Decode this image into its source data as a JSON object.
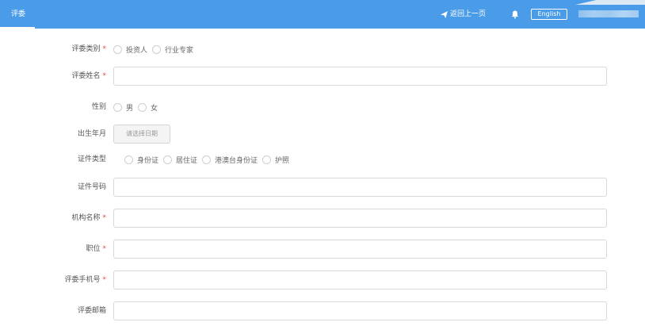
{
  "header": {
    "tab_label": "评委",
    "back_label": "返回上一页",
    "lang_label": "English"
  },
  "form": {
    "judge_type": {
      "label": "评委类别",
      "required": "*",
      "options": [
        "投资人",
        "行业专家"
      ]
    },
    "judge_name": {
      "label": "评委姓名",
      "required": "*",
      "value": ""
    },
    "gender": {
      "label": "性别",
      "options": [
        "男",
        "女"
      ]
    },
    "birth": {
      "label": "出生年月",
      "button": "请选择日期"
    },
    "id_type": {
      "label": "证件类型",
      "options": [
        "身份证",
        "居住证",
        "港澳台身份证",
        "护照"
      ]
    },
    "id_number": {
      "label": "证件号码",
      "value": ""
    },
    "org_name": {
      "label": "机构名称",
      "required": "*",
      "value": ""
    },
    "position": {
      "label": "职位",
      "required": "*",
      "value": ""
    },
    "phone": {
      "label": "评委手机号",
      "required": "*",
      "value": ""
    },
    "email": {
      "label": "评委邮箱",
      "value": ""
    }
  },
  "colors": {
    "header_bg": "#4a9be8",
    "required": "#e84545"
  },
  "icons": {
    "back": "send-icon",
    "notify": "bell-icon"
  }
}
